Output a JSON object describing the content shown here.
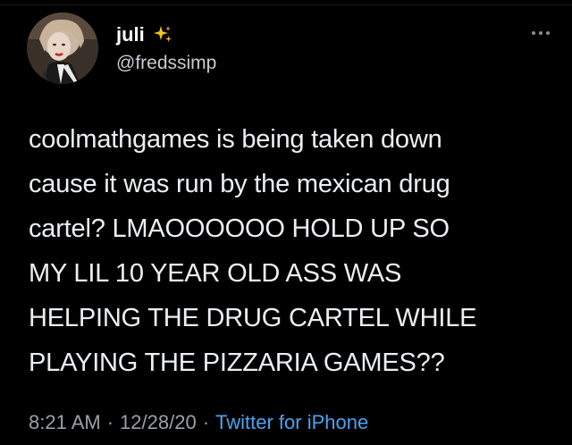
{
  "tweet": {
    "author": {
      "display_name": "juli",
      "handle": "@fredssimp",
      "avatar_icon": "profile-photo",
      "name_emoji_icon": "sparkles-icon"
    },
    "more_icon": "ellipsis-icon",
    "text_lines": [
      "coolmathgames is being taken down",
      "cause it was run by the mexican drug",
      "cartel? LMAOOOOOO HOLD UP SO",
      "MY LIL 10 YEAR OLD ASS WAS",
      "HELPING THE DRUG CARTEL WHILE",
      "PLAYING THE PIZZARIA GAMES??"
    ],
    "time": "8:21 AM",
    "date": "12/28/20",
    "separator": "·",
    "source": "Twitter for iPhone"
  },
  "colors": {
    "background": "#000000",
    "text": "#eceff1",
    "secondary": "#9aa0a6",
    "link": "#4aa3f0",
    "sparkle": "#f5c518"
  }
}
